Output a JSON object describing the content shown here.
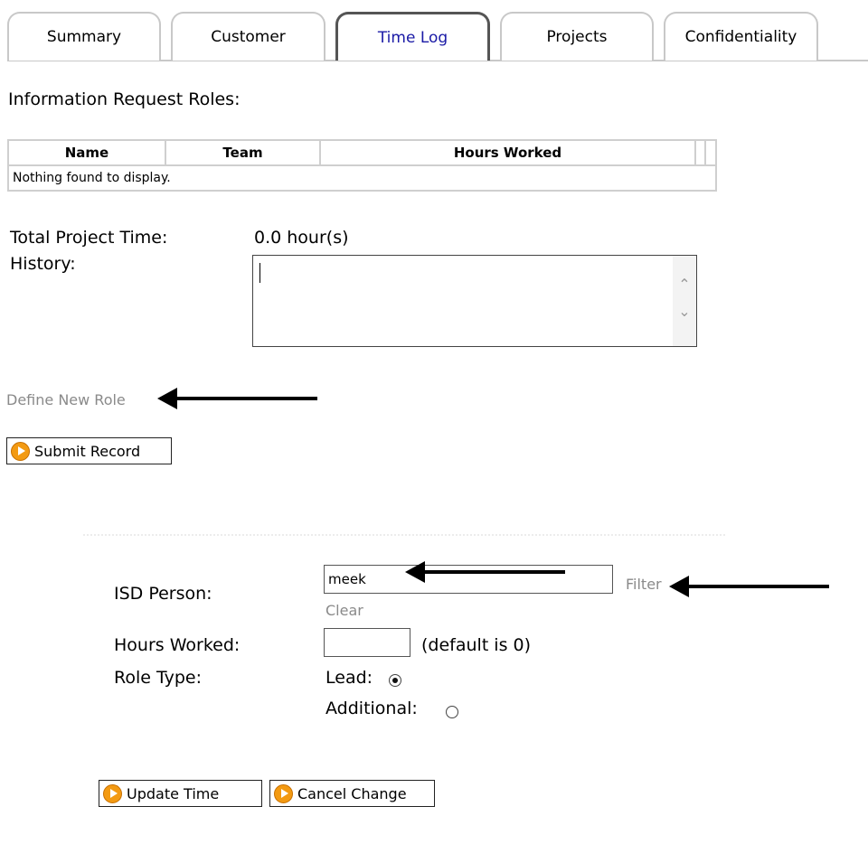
{
  "tabs": [
    {
      "label": "Summary"
    },
    {
      "label": "Customer"
    },
    {
      "label": "Time Log"
    },
    {
      "label": "Projects"
    },
    {
      "label": "Confidentiality"
    }
  ],
  "active_tab": "Time Log",
  "roles": {
    "title": "Information Request Roles:",
    "columns": [
      "Name",
      "Team",
      "Hours Worked"
    ],
    "empty_message": "Nothing found to display."
  },
  "project_time": {
    "total_label": "Total Project Time:",
    "total_value": "0.0 hour(s)",
    "history_label": "History:",
    "history_value": ""
  },
  "define_new_role": "Define New Role",
  "submit_record": "Submit Record",
  "role_form": {
    "isd_person_label": "ISD Person:",
    "isd_person_value": "meek",
    "filter_link": "Filter",
    "clear_link": "Clear",
    "hours_worked_label": "Hours Worked:",
    "hours_worked_value": "",
    "hours_hint": "(default is 0)",
    "role_type_label": "Role Type:",
    "lead_label": "Lead:",
    "lead_selected": true,
    "additional_label": "Additional:",
    "additional_selected": false
  },
  "update_time": "Update Time",
  "cancel_change": "Cancel Change",
  "colors": {
    "active_tab_text": "#1a1aa6",
    "link": "#8a8a8a",
    "button_icon": "#f39a12"
  }
}
